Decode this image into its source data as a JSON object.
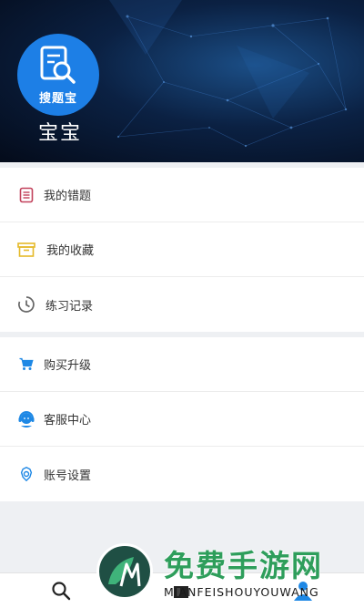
{
  "header": {
    "logo_text": "搜题宝",
    "username": "宝宝"
  },
  "menu_group_1": [
    {
      "label": "我的错题",
      "icon": "wrong-questions-icon",
      "color": "#c2415b"
    },
    {
      "label": "我的收藏",
      "icon": "favorites-box-icon",
      "color": "#e5b929"
    },
    {
      "label": "练习记录",
      "icon": "history-clock-icon",
      "color": "#666666"
    }
  ],
  "menu_group_2": [
    {
      "label": "购买升级",
      "icon": "cart-icon",
      "color": "#1e88e5"
    },
    {
      "label": "客服中心",
      "icon": "customer-service-icon",
      "color": "#1e88e5"
    },
    {
      "label": "账号设置",
      "icon": "settings-gear-icon",
      "color": "#1e88e5"
    }
  ],
  "watermark": {
    "title": "免费手游网",
    "subtitle": "MIANFEISHOUYOUWANG",
    "logo_letter": "M"
  },
  "colors": {
    "accent": "#1e88e5",
    "header_dark": "#040b1a"
  }
}
